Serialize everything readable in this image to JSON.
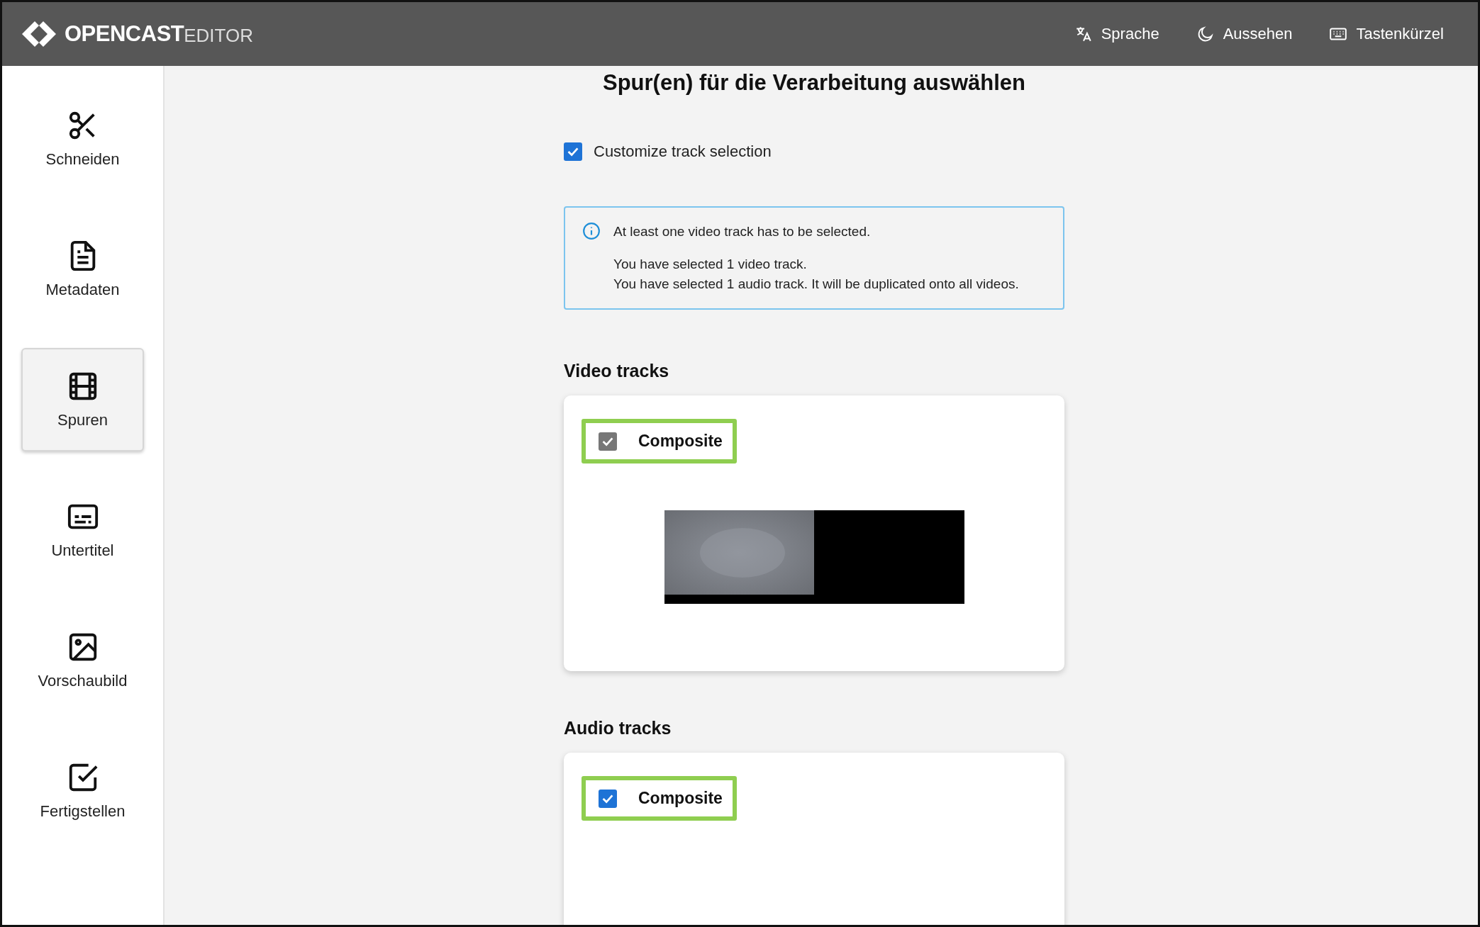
{
  "header": {
    "logo_main": "OPENCAST",
    "logo_sub": "EDITOR",
    "actions": [
      {
        "label": "Sprache"
      },
      {
        "label": "Aussehen"
      },
      {
        "label": "Tastenkürzel"
      }
    ]
  },
  "sidebar": {
    "items": [
      {
        "label": "Schneiden",
        "selected": false
      },
      {
        "label": "Metadaten",
        "selected": false
      },
      {
        "label": "Spuren",
        "selected": true
      },
      {
        "label": "Untertitel",
        "selected": false
      },
      {
        "label": "Vorschaubild",
        "selected": false
      },
      {
        "label": "Fertigstellen",
        "selected": false
      }
    ]
  },
  "main": {
    "title": "Spur(en) für die Verarbeitung auswählen",
    "customize": {
      "label": "Customize track selection",
      "checked": true
    },
    "info": {
      "message": "At least one video track has to be selected.",
      "details": [
        "You have selected 1 video track.",
        "You have selected 1 audio track. It will be duplicated onto all videos."
      ]
    },
    "sections": [
      {
        "heading": "Video tracks",
        "tracks": [
          {
            "label": "Composite",
            "checked": true,
            "disabled": true,
            "highlighted": true
          }
        ]
      },
      {
        "heading": "Audio tracks",
        "tracks": [
          {
            "label": "Composite",
            "checked": true,
            "disabled": false,
            "highlighted": true
          }
        ]
      }
    ]
  }
}
